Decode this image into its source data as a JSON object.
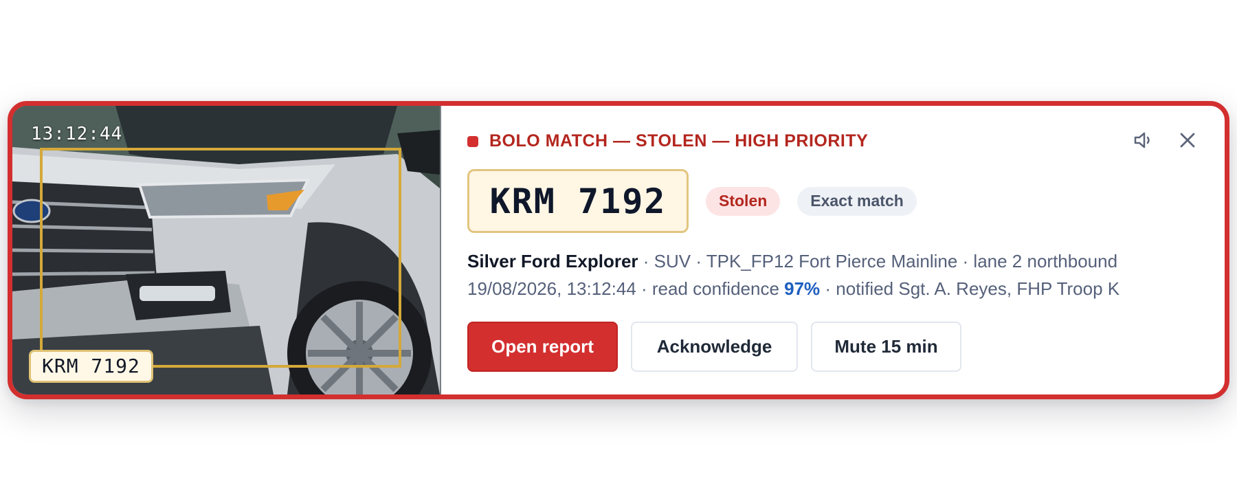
{
  "snapshot": {
    "timestamp": "13:12:44",
    "plate_overlay": "KRM 7192"
  },
  "alert": {
    "title": "BOLO MATCH — STOLEN — HIGH PRIORITY",
    "accent_color": "#d32f2f",
    "icons": [
      "speaker-icon",
      "close-icon"
    ]
  },
  "plate": {
    "number": "KRM 7192",
    "badges": [
      "Stolen",
      "Exact match"
    ]
  },
  "details": {
    "vehicle": "Silver Ford Explorer",
    "line1_rest": " · SUV · TPK_FP12 Fort Pierce Mainline · lane 2 northbound",
    "line2_before": "19/08/2026, 13:12:44 · read confidence ",
    "confidence": "97%",
    "line2_after": " · notified Sgt. A. Reyes, FHP Troop K"
  },
  "actions": {
    "open": "Open report",
    "acknowledge": "Acknowledge",
    "mute": "Mute 15 min"
  }
}
